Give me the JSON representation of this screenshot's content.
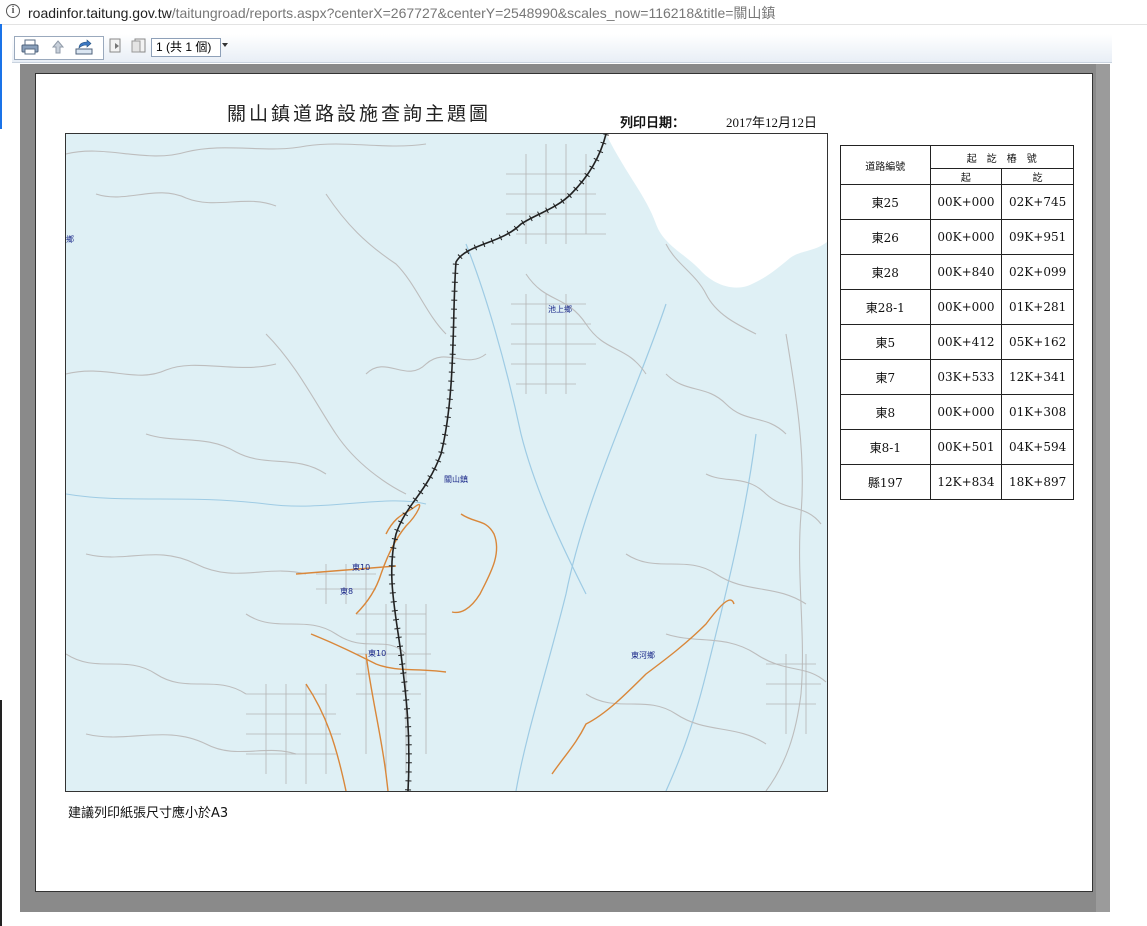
{
  "browser": {
    "url_host": "roadinfor.taitung.gov.tw",
    "url_rest": "/taitungroad/reports.aspx?centerX=267727&centerY=2548990&scales_now=116218&title=關山鎮"
  },
  "toolbar": {
    "page_indicator": "1 (共 1 個)"
  },
  "report": {
    "title": "關山鎮道路設施查詢主題圖",
    "print_date_label": "列印日期：",
    "print_date_value": "2017年12月12日",
    "paper_note": "建議列印紙張尺寸應小於A3"
  },
  "map": {
    "labels": [
      "池上鄉",
      "關山鎮",
      "東河鄉",
      "鄉",
      "東10",
      "東8",
      "東10"
    ],
    "colors": {
      "land": "#dff0f5",
      "roads": "#bdbdbd",
      "county_roads": "#d9873a",
      "rail": "#222222",
      "rivers": "#9ecbe4"
    }
  },
  "table": {
    "header_road_id": "道路編號",
    "header_range": "起　訖　樁　號",
    "header_start": "起",
    "header_end": "訖",
    "rows": [
      {
        "id": "東25",
        "start": "00K+000",
        "end": "02K+745"
      },
      {
        "id": "東26",
        "start": "00K+000",
        "end": "09K+951"
      },
      {
        "id": "東28",
        "start": "00K+840",
        "end": "02K+099"
      },
      {
        "id": "東28-1",
        "start": "00K+000",
        "end": "01K+281"
      },
      {
        "id": "東5",
        "start": "00K+412",
        "end": "05K+162"
      },
      {
        "id": "東7",
        "start": "03K+533",
        "end": "12K+341"
      },
      {
        "id": "東8",
        "start": "00K+000",
        "end": "01K+308"
      },
      {
        "id": "東8-1",
        "start": "00K+501",
        "end": "04K+594"
      },
      {
        "id": "縣197",
        "start": "12K+834",
        "end": "18K+897"
      }
    ]
  }
}
